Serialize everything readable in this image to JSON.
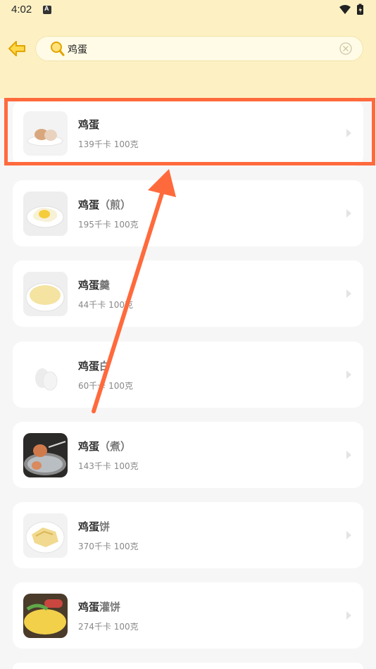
{
  "status_bar": {
    "time": "4:02",
    "icons": [
      "notification-a-icon",
      "wifi-icon",
      "battery-icon"
    ]
  },
  "header": {
    "back_icon": "arrow-left-icon",
    "search": {
      "query": "鸡蛋",
      "icon": "search-icon",
      "clear_icon": "clear-icon"
    }
  },
  "results": [
    {
      "name": "鸡蛋",
      "suffix": "",
      "calories": "139千卡",
      "amount": "100克",
      "highlighted": true
    },
    {
      "name": "鸡蛋",
      "suffix": "（煎）",
      "calories": "195千卡",
      "amount": "100克"
    },
    {
      "name": "鸡蛋",
      "suffix": "羹",
      "calories": "44千卡",
      "amount": "100克"
    },
    {
      "name": "鸡蛋",
      "suffix": "白",
      "calories": "60千卡",
      "amount": "100克"
    },
    {
      "name": "鸡蛋",
      "suffix": "（煮）",
      "calories": "143千卡",
      "amount": "100克"
    },
    {
      "name": "鸡蛋",
      "suffix": "饼",
      "calories": "370千卡",
      "amount": "100克"
    },
    {
      "name": "鸡蛋",
      "suffix": "灌饼",
      "calories": "274千卡",
      "amount": "100克"
    }
  ],
  "colors": {
    "header_bg": "#fdf1c4",
    "accent": "#f5b800",
    "annotation": "#ff6a3d"
  }
}
